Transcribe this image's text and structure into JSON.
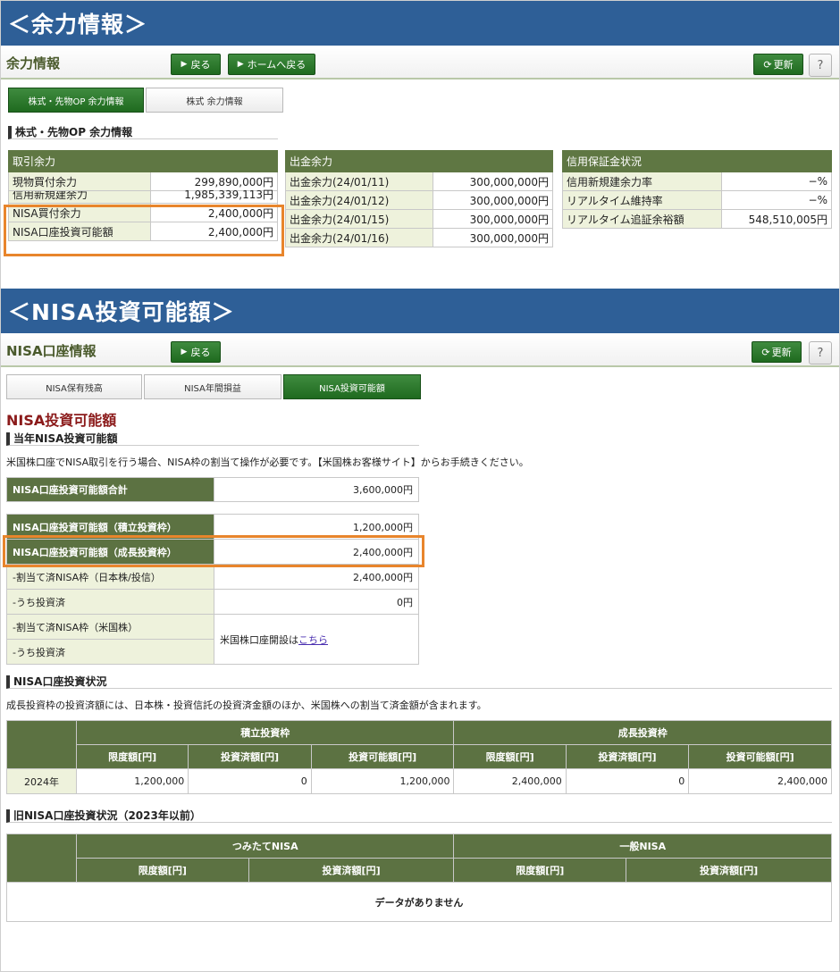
{
  "banner1": "＜余力情報＞",
  "banner2": "＜NISA投資可能額＞",
  "toolbar1": {
    "title": "余力情報",
    "back": "戻る",
    "home": "ホームへ戻る",
    "refresh": "更新",
    "help": "?"
  },
  "tabs1": [
    "株式・先物OP 余力情報",
    "株式 余力情報"
  ],
  "section1_head": "株式・先物OP 余力情報",
  "table_trade": {
    "header": "取引余力",
    "rows": [
      {
        "label": "現物買付余力",
        "value": "299,890,000円"
      },
      {
        "label": "信用新規建余力",
        "value": "1,985,339,113円"
      },
      {
        "label": "NISA買付余力",
        "value": "2,400,000円"
      },
      {
        "label": "NISA口座投資可能額",
        "value": "2,400,000円"
      }
    ]
  },
  "table_withdraw": {
    "header": "出金余力",
    "rows": [
      {
        "label": "出金余力(24/01/11)",
        "value": "300,000,000円"
      },
      {
        "label": "出金余力(24/01/12)",
        "value": "300,000,000円"
      },
      {
        "label": "出金余力(24/01/15)",
        "value": "300,000,000円"
      },
      {
        "label": "出金余力(24/01/16)",
        "value": "300,000,000円"
      }
    ]
  },
  "table_margin": {
    "header": "信用保証金状況",
    "rows": [
      {
        "label": "信用新規建余力率",
        "value": "−%"
      },
      {
        "label": "リアルタイム維持率",
        "value": "−%"
      },
      {
        "label": "リアルタイム追証余裕額",
        "value": "548,510,005円"
      }
    ]
  },
  "toolbar2": {
    "title": "NISA口座情報",
    "back": "戻る",
    "refresh": "更新",
    "help": "?"
  },
  "tabs2": [
    "NISA保有残高",
    "NISA年間損益",
    "NISA投資可能額"
  ],
  "nisa_title": "NISA投資可能額",
  "current_head": "当年NISA投資可能額",
  "current_note": "米国株口座でNISA取引を行う場合、NISA枠の割当て操作が必要です。【米国株お客様サイト】からお手続きください。",
  "nisa_total": {
    "label": "NISA口座投資可能額合計",
    "value": "3,600,000円"
  },
  "nisa_rows": [
    {
      "label": "NISA口座投資可能額（積立投資枠）",
      "value": "1,200,000円"
    },
    {
      "label": "NISA口座投資可能額（成長投資枠）",
      "value": "2,400,000円"
    },
    {
      "label": "-割当て済NISA枠（日本株/投信）",
      "value": "2,400,000円"
    },
    {
      "label": "-うち投資済",
      "value": "0円"
    },
    {
      "label": "-割当て済NISA枠（米国株）",
      "value": ""
    },
    {
      "label": "-うち投資済",
      "value": ""
    }
  ],
  "us_open_text": "米国株口座開設は",
  "us_open_link": "こちら",
  "status_head": "NISA口座投資状況",
  "status_note": "成長投資枠の投資済額には、日本株・投資信託の投資済金額のほか、米国株への割当て済金額が含まれます。",
  "status_table": {
    "group1": "積立投資枠",
    "group2": "成長投資枠",
    "cols": [
      "限度額[円]",
      "投資済額[円]",
      "投資可能額[円]",
      "限度額[円]",
      "投資済額[円]",
      "投資可能額[円]"
    ],
    "row": {
      "year": "2024年",
      "values": [
        "1,200,000",
        "0",
        "1,200,000",
        "2,400,000",
        "0",
        "2,400,000"
      ]
    }
  },
  "old_head": "旧NISA口座投資状況（2023年以前）",
  "old_table": {
    "group1": "つみたてNISA",
    "group2": "一般NISA",
    "cols": [
      "限度額[円]",
      "投資済額[円]",
      "限度額[円]",
      "投資済額[円]"
    ],
    "empty": "データがありません"
  }
}
